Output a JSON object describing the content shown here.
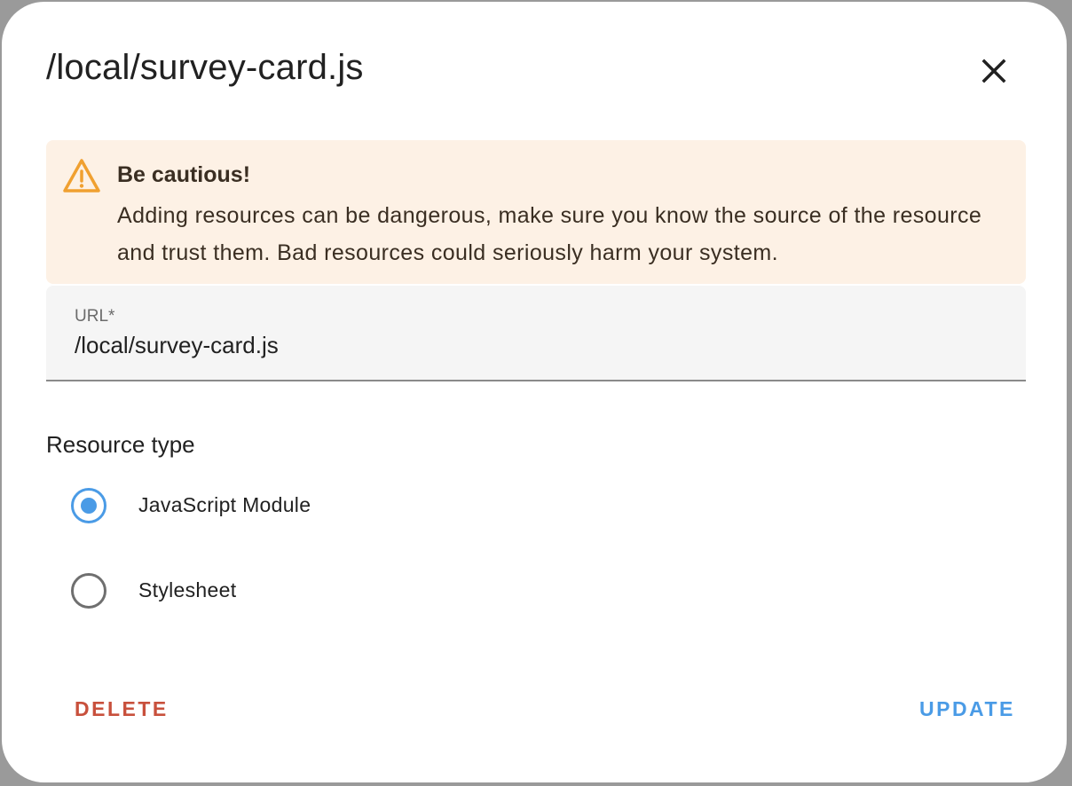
{
  "dialog": {
    "title": "/local/survey-card.js"
  },
  "alert": {
    "title": "Be cautious!",
    "body": "Adding resources can be dangerous, make sure you know the source of the resource and trust them. Bad resources could seriously harm your system.",
    "icon": "warning-icon",
    "color": "#f0a030"
  },
  "url_field": {
    "label": "URL*",
    "value": "/local/survey-card.js"
  },
  "resource_type": {
    "label": "Resource type",
    "options": [
      {
        "label": "JavaScript Module",
        "checked": true
      },
      {
        "label": "Stylesheet",
        "checked": false
      }
    ]
  },
  "actions": {
    "delete_label": "DELETE",
    "update_label": "UPDATE"
  },
  "colors": {
    "accent": "#4a9be6",
    "danger": "#c8503c",
    "alert_bg": "#fdf1e5"
  }
}
